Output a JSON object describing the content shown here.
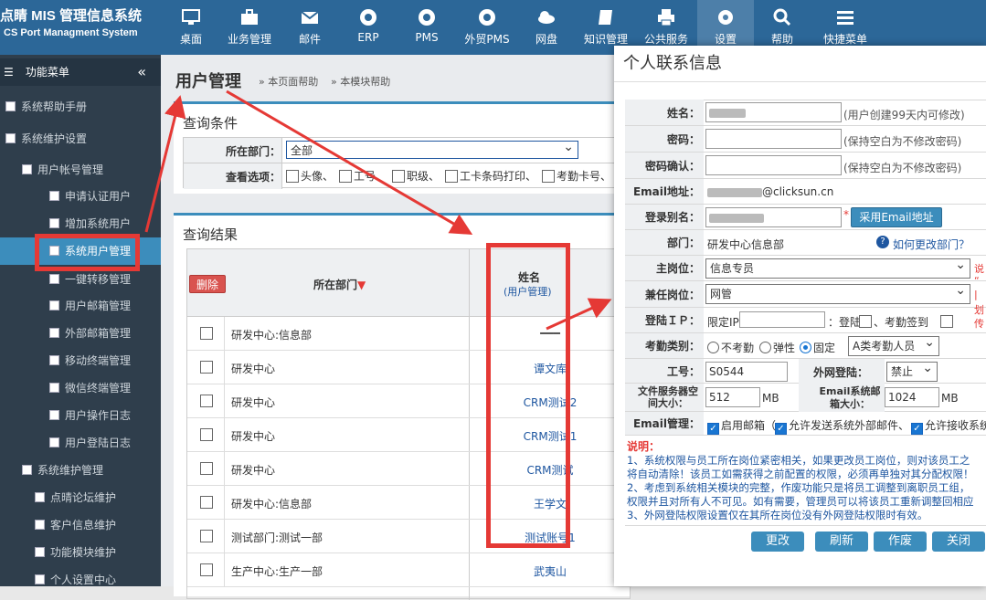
{
  "brand": {
    "title": "点睛 MIS 管理信息系统",
    "subtitle": "CS Port Managment System"
  },
  "nav": [
    {
      "label": "桌面",
      "icon": "desktop-icon"
    },
    {
      "label": "业务管理",
      "icon": "briefcase-icon"
    },
    {
      "label": "邮件",
      "icon": "mail-icon"
    },
    {
      "label": "ERP",
      "icon": "chrome-icon"
    },
    {
      "label": "PMS",
      "icon": "chrome-icon"
    },
    {
      "label": "外贸PMS",
      "icon": "chrome-icon"
    },
    {
      "label": "网盘",
      "icon": "cloud-icon"
    },
    {
      "label": "知识管理",
      "icon": "book-icon"
    },
    {
      "label": "公共服务",
      "icon": "printer-icon"
    },
    {
      "label": "设置",
      "icon": "gear-icon"
    },
    {
      "label": "帮助",
      "icon": "search-icon"
    },
    {
      "label": "快捷菜单",
      "icon": "menu-icon"
    }
  ],
  "sidebar": {
    "header": "功能菜单",
    "items": [
      "系统帮助手册",
      "系统维护设置",
      "用户帐号管理",
      "申请认证用户",
      "增加系统用户",
      "系统用户管理",
      "一键转移管理",
      "用户邮箱管理",
      "外部邮箱管理",
      "移动终端管理",
      "微信终端管理",
      "用户操作日志",
      "用户登陆日志",
      "系统维护管理",
      "点晴论坛维护",
      "客户信息维护",
      "功能模块维护",
      "个人设置中心"
    ]
  },
  "page": {
    "title": "用户管理",
    "help1": "» 本页面帮助",
    "help2": "» 本模块帮助"
  },
  "query": {
    "title": "查询条件",
    "dept_label": "所在部门：",
    "dept_value": "全部",
    "opt_label": "查看选项：",
    "options": [
      "头像、",
      "工号、",
      "职级、",
      "工卡条码打印、",
      "考勤卡号、"
    ]
  },
  "results": {
    "title": "查询结果",
    "delete": "删除",
    "col_dept": "所在部门",
    "col_name": "姓名",
    "col_name_sub": "(用户管理)",
    "rows": [
      {
        "dept": "研发中心:信息部",
        "name": "━━━"
      },
      {
        "dept": "研发中心",
        "name": "谭文库"
      },
      {
        "dept": "研发中心",
        "name": "CRM测试2"
      },
      {
        "dept": "研发中心",
        "name": "CRM测试1"
      },
      {
        "dept": "研发中心",
        "name": "CRM测试"
      },
      {
        "dept": "研发中心:信息部",
        "name": "王学文"
      },
      {
        "dept": "测试部门:测试一部",
        "name": "测试账号1"
      },
      {
        "dept": "生产中心:生产一部",
        "name": "武夷山"
      }
    ]
  },
  "dialog": {
    "title": "个人联系信息",
    "name_label": "姓名：",
    "name_hint": "(用户创建99天内可修改)",
    "pwd_label": "密码：",
    "pwd_hint": "(保持空白为不修改密码)",
    "pwd2_label": "密码确认：",
    "pwd2_hint": "(保持空白为不修改密码)",
    "email_label": "Email地址：",
    "email_value": "@clicksun.cn",
    "alias_label": "登录别名：",
    "alias_btn": "采用Email地址",
    "dept_label": "部门：",
    "dept_value": "研发中心信息部",
    "dept_link": "如何更改部门？",
    "post_label": "主岗位：",
    "post_value": "信息专员",
    "sidepost_label": "兼任岗位：",
    "sidepost_value": "网管",
    "ip_label": "登陆ＩＰ：",
    "ip_text": "限定IP",
    "ip_login": "：登陆",
    "ip_att": "、考勤签到",
    "att_label": "考勤类别：",
    "att_opts": [
      "不考勤",
      "弹性",
      "固定"
    ],
    "att_type": "A类考勤人员",
    "empno_label": "工号：",
    "empno_value": "S0544",
    "extlogin_label": "外网登陆：",
    "extlogin_value": "禁止",
    "fs_label": "文件服务器空间大小：",
    "fs_value": "512",
    "fs_unit": "MB",
    "mail_size_label": "Email系统邮箱大小：",
    "mail_size_value": "1024",
    "mail_unit": "MB",
    "mail_mgmt_label": "Email管理：",
    "mail_opts": [
      "启用邮箱（",
      "允许发送系统外部邮件、",
      "允许接收系统"
    ],
    "note_title": "说明：",
    "notes": [
      "1、系统权限与员工所在岗位紧密相关，如果更改员工岗位，则对该员工之",
      "将自动清除！该员工如需获得之前配置的权限，必须再单独对其分配权限！",
      "2、考虑到系统相关模块的完整，作废功能只是将员工调整到离职员工组，",
      "权限并且对所有人不可见。如有需要，管理员可以将该员工重新调整回相应",
      "3、外网登陆权限设置仅在其所在岗位没有外网登陆权限时有效。"
    ],
    "buttons": [
      "更改",
      "刷新",
      "作废",
      "关闭"
    ],
    "side_red": [
      "说",
      "“",
      "|",
      "划",
      "传"
    ]
  },
  "colors": {
    "topbar": "#2c6798",
    "sidebar": "#2f3e4c",
    "active": "#3c8dbc",
    "annotation": "#e53935"
  }
}
